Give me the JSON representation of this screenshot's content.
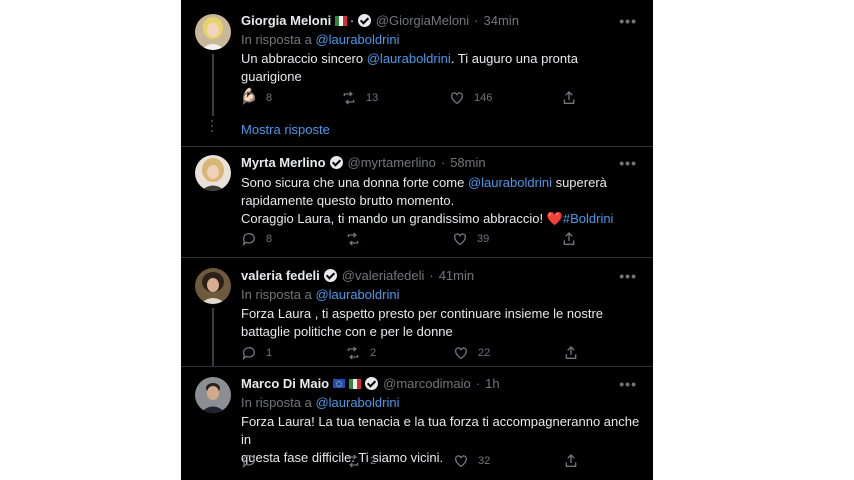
{
  "tweets": [
    {
      "name": "Giorgia Meloni",
      "flag_note": "🇮🇹",
      "extra_glyph": "🐢",
      "handle": "@GiorgiaMeloni",
      "time": "34min",
      "reply_prefix": "In risposta a",
      "reply_to": "@lauraboldrini",
      "body_pre": "Un abbraccio sincero ",
      "body_mention": "@lauraboldrini",
      "body_post": ". Ti auguro una pronta guarigione",
      "body_emoji": "💪🏻",
      "replies": "8",
      "retweets": "13",
      "likes": "146",
      "show_replies": "Mostra risposte"
    },
    {
      "name": "Myrta Merlino",
      "handle": "@myrtamerlino",
      "time": "58min",
      "line1_pre": "Sono sicura che una donna forte come ",
      "line1_mention": "@lauraboldrini",
      "line1_post": " supererà",
      "line2": "rapidamente questo brutto momento.",
      "line3": "Coraggio Laura, ti mando un grandissimo abbraccio! ",
      "line3_heart": "❤️",
      "line3_hashtag": "#Boldrini",
      "replies": "8",
      "retweets": "",
      "likes": "39"
    },
    {
      "name": "valeria fedeli",
      "handle": "@valeriafedeli",
      "time": "41min",
      "reply_prefix": "In risposta a",
      "reply_to": "@lauraboldrini",
      "line1": "Forza Laura , ti aspetto presto per continuare insieme le nostre",
      "line2": "battaglie politiche con e per le donne",
      "replies": "1",
      "retweets": "2",
      "likes": "22"
    },
    {
      "name": "Marco Di Maio",
      "handle": "@marcodimaio",
      "time": "1h",
      "reply_prefix": "In risposta a",
      "reply_to": "@lauraboldrini",
      "line1": "Forza Laura! La tua tenacia e la tua forza ti accompagneranno anche in",
      "line2": "questa fase difficile. Ti siamo vicini.",
      "replies": "",
      "retweets": "2",
      "likes": "32"
    }
  ],
  "separator": "·",
  "more_glyph": "•••",
  "colors": {
    "background": "#000000",
    "link": "#4a99e9",
    "muted": "#71767b",
    "text": "#e7e9ea"
  }
}
